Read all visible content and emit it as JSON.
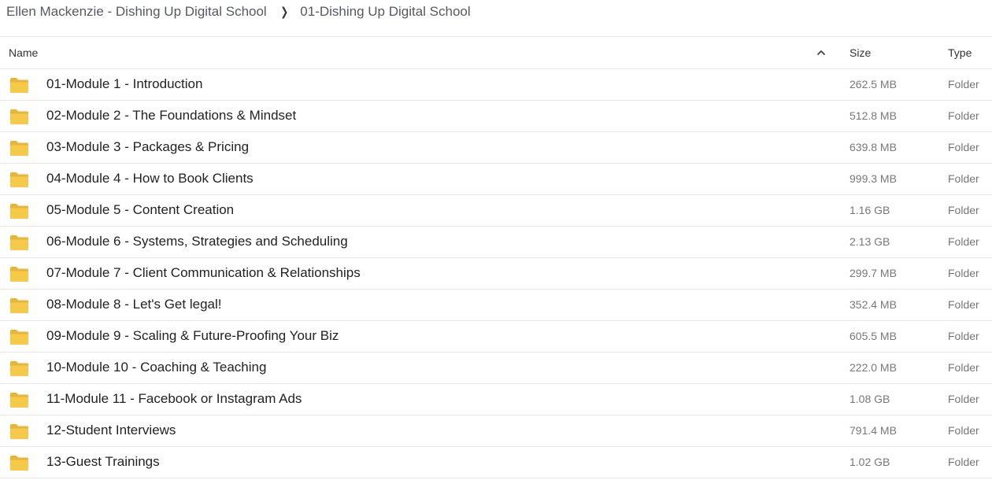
{
  "breadcrumb": {
    "parent": "Ellen Mackenzie - Dishing Up Digital School",
    "current": "01-Dishing Up Digital School"
  },
  "table": {
    "headers": {
      "name": "Name",
      "size": "Size",
      "type": "Type"
    },
    "sort": {
      "column": "name",
      "direction": "ascending",
      "icon": "chevron-up-icon"
    },
    "rows": [
      {
        "icon": "folder-icon",
        "name": "01-Module 1 - Introduction",
        "size": "262.5 MB",
        "type": "Folder"
      },
      {
        "icon": "folder-icon",
        "name": "02-Module 2 - The Foundations & Mindset",
        "size": "512.8 MB",
        "type": "Folder"
      },
      {
        "icon": "folder-icon",
        "name": "03-Module 3 - Packages & Pricing",
        "size": "639.8 MB",
        "type": "Folder"
      },
      {
        "icon": "folder-icon",
        "name": "04-Module 4 - How to Book Clients",
        "size": "999.3 MB",
        "type": "Folder"
      },
      {
        "icon": "folder-icon",
        "name": "05-Module 5 - Content Creation",
        "size": "1.16 GB",
        "type": "Folder"
      },
      {
        "icon": "folder-icon",
        "name": "06-Module 6 - Systems, Strategies and Scheduling",
        "size": "2.13 GB",
        "type": "Folder"
      },
      {
        "icon": "folder-icon",
        "name": "07-Module 7 - Client Communication & Relationships",
        "size": "299.7 MB",
        "type": "Folder"
      },
      {
        "icon": "folder-icon",
        "name": "08-Module 8 - Let's Get legal!",
        "size": "352.4 MB",
        "type": "Folder"
      },
      {
        "icon": "folder-icon",
        "name": "09-Module 9 - Scaling & Future-Proofing Your Biz",
        "size": "605.5 MB",
        "type": "Folder"
      },
      {
        "icon": "folder-icon",
        "name": "10-Module 10 - Coaching & Teaching",
        "size": "222.0 MB",
        "type": "Folder"
      },
      {
        "icon": "folder-icon",
        "name": "11-Module 11 - Facebook or Instagram Ads",
        "size": "1.08 GB",
        "type": "Folder"
      },
      {
        "icon": "folder-icon",
        "name": "12-Student Interviews",
        "size": "791.4 MB",
        "type": "Folder"
      },
      {
        "icon": "folder-icon",
        "name": "13-Guest Trainings",
        "size": "1.02 GB",
        "type": "Folder"
      }
    ]
  },
  "colors": {
    "folder_fill": "#F7C948",
    "folder_tab": "#E8B53A",
    "divider": "#E6E6E6",
    "secondary_text": "#777777"
  }
}
